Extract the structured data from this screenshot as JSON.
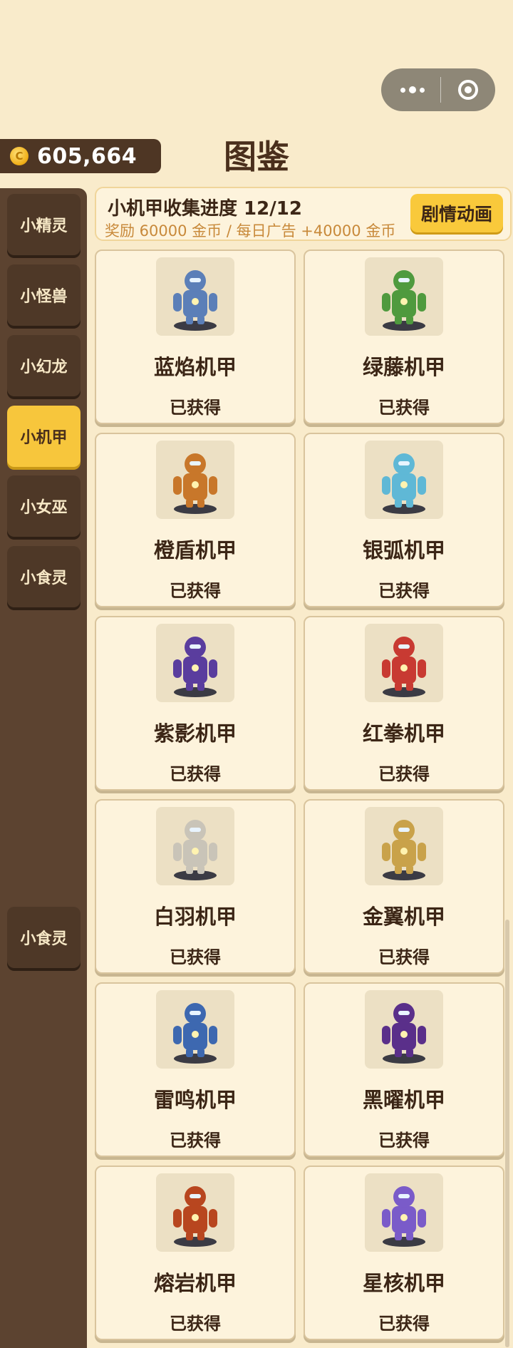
{
  "coins": {
    "value": "605,664",
    "icon": "coin-icon"
  },
  "page": {
    "title": "图鉴"
  },
  "sidebar": {
    "items": [
      {
        "label": "小精灵"
      },
      {
        "label": "小怪兽"
      },
      {
        "label": "小幻龙"
      },
      {
        "label": "小机甲",
        "active": true
      },
      {
        "label": "小女巫"
      },
      {
        "label": "小食灵"
      }
    ],
    "ghost_item": {
      "label": "小食灵"
    }
  },
  "collection": {
    "progress_title": "小机甲收集进度 12/12",
    "reward_text": "奖励 60000 金币 / 每日广告 +40000 金币",
    "story_button": "剧情动画"
  },
  "mechs": [
    {
      "name": "蓝焰机甲",
      "status": "已获得",
      "accent": "#5b7fb8"
    },
    {
      "name": "绿藤机甲",
      "status": "已获得",
      "accent": "#4f9a3e"
    },
    {
      "name": "橙盾机甲",
      "status": "已获得",
      "accent": "#c8772a"
    },
    {
      "name": "银弧机甲",
      "status": "已获得",
      "accent": "#5fb8d6"
    },
    {
      "name": "紫影机甲",
      "status": "已获得",
      "accent": "#5a3d9e"
    },
    {
      "name": "红拳机甲",
      "status": "已获得",
      "accent": "#c83a32"
    },
    {
      "name": "白羽机甲",
      "status": "已获得",
      "accent": "#c9c4b8"
    },
    {
      "name": "金翼机甲",
      "status": "已获得",
      "accent": "#c9a24a"
    },
    {
      "name": "雷鸣机甲",
      "status": "已获得",
      "accent": "#3d68b0"
    },
    {
      "name": "黑曜机甲",
      "status": "已获得",
      "accent": "#5a2f8a"
    },
    {
      "name": "熔岩机甲",
      "status": "已获得",
      "accent": "#b8461f"
    },
    {
      "name": "星核机甲",
      "status": "已获得",
      "accent": "#7a5bc9"
    }
  ]
}
